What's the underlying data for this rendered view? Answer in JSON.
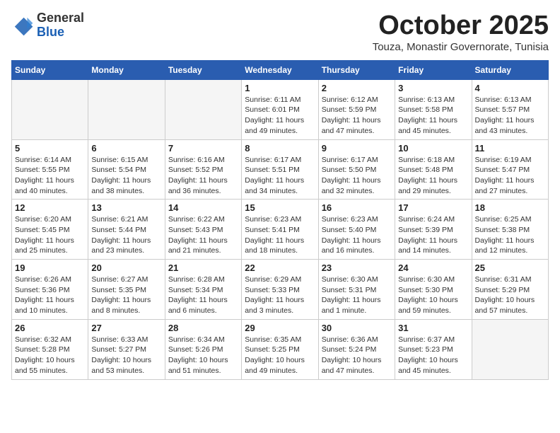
{
  "header": {
    "logo_general": "General",
    "logo_blue": "Blue",
    "month_title": "October 2025",
    "location": "Touza, Monastir Governorate, Tunisia"
  },
  "calendar": {
    "weekdays": [
      "Sunday",
      "Monday",
      "Tuesday",
      "Wednesday",
      "Thursday",
      "Friday",
      "Saturday"
    ],
    "weeks": [
      [
        {
          "day": "",
          "info": ""
        },
        {
          "day": "",
          "info": ""
        },
        {
          "day": "",
          "info": ""
        },
        {
          "day": "1",
          "info": "Sunrise: 6:11 AM\nSunset: 6:01 PM\nDaylight: 11 hours\nand 49 minutes."
        },
        {
          "day": "2",
          "info": "Sunrise: 6:12 AM\nSunset: 5:59 PM\nDaylight: 11 hours\nand 47 minutes."
        },
        {
          "day": "3",
          "info": "Sunrise: 6:13 AM\nSunset: 5:58 PM\nDaylight: 11 hours\nand 45 minutes."
        },
        {
          "day": "4",
          "info": "Sunrise: 6:13 AM\nSunset: 5:57 PM\nDaylight: 11 hours\nand 43 minutes."
        }
      ],
      [
        {
          "day": "5",
          "info": "Sunrise: 6:14 AM\nSunset: 5:55 PM\nDaylight: 11 hours\nand 40 minutes."
        },
        {
          "day": "6",
          "info": "Sunrise: 6:15 AM\nSunset: 5:54 PM\nDaylight: 11 hours\nand 38 minutes."
        },
        {
          "day": "7",
          "info": "Sunrise: 6:16 AM\nSunset: 5:52 PM\nDaylight: 11 hours\nand 36 minutes."
        },
        {
          "day": "8",
          "info": "Sunrise: 6:17 AM\nSunset: 5:51 PM\nDaylight: 11 hours\nand 34 minutes."
        },
        {
          "day": "9",
          "info": "Sunrise: 6:17 AM\nSunset: 5:50 PM\nDaylight: 11 hours\nand 32 minutes."
        },
        {
          "day": "10",
          "info": "Sunrise: 6:18 AM\nSunset: 5:48 PM\nDaylight: 11 hours\nand 29 minutes."
        },
        {
          "day": "11",
          "info": "Sunrise: 6:19 AM\nSunset: 5:47 PM\nDaylight: 11 hours\nand 27 minutes."
        }
      ],
      [
        {
          "day": "12",
          "info": "Sunrise: 6:20 AM\nSunset: 5:45 PM\nDaylight: 11 hours\nand 25 minutes."
        },
        {
          "day": "13",
          "info": "Sunrise: 6:21 AM\nSunset: 5:44 PM\nDaylight: 11 hours\nand 23 minutes."
        },
        {
          "day": "14",
          "info": "Sunrise: 6:22 AM\nSunset: 5:43 PM\nDaylight: 11 hours\nand 21 minutes."
        },
        {
          "day": "15",
          "info": "Sunrise: 6:23 AM\nSunset: 5:41 PM\nDaylight: 11 hours\nand 18 minutes."
        },
        {
          "day": "16",
          "info": "Sunrise: 6:23 AM\nSunset: 5:40 PM\nDaylight: 11 hours\nand 16 minutes."
        },
        {
          "day": "17",
          "info": "Sunrise: 6:24 AM\nSunset: 5:39 PM\nDaylight: 11 hours\nand 14 minutes."
        },
        {
          "day": "18",
          "info": "Sunrise: 6:25 AM\nSunset: 5:38 PM\nDaylight: 11 hours\nand 12 minutes."
        }
      ],
      [
        {
          "day": "19",
          "info": "Sunrise: 6:26 AM\nSunset: 5:36 PM\nDaylight: 11 hours\nand 10 minutes."
        },
        {
          "day": "20",
          "info": "Sunrise: 6:27 AM\nSunset: 5:35 PM\nDaylight: 11 hours\nand 8 minutes."
        },
        {
          "day": "21",
          "info": "Sunrise: 6:28 AM\nSunset: 5:34 PM\nDaylight: 11 hours\nand 6 minutes."
        },
        {
          "day": "22",
          "info": "Sunrise: 6:29 AM\nSunset: 5:33 PM\nDaylight: 11 hours\nand 3 minutes."
        },
        {
          "day": "23",
          "info": "Sunrise: 6:30 AM\nSunset: 5:31 PM\nDaylight: 11 hours\nand 1 minute."
        },
        {
          "day": "24",
          "info": "Sunrise: 6:30 AM\nSunset: 5:30 PM\nDaylight: 10 hours\nand 59 minutes."
        },
        {
          "day": "25",
          "info": "Sunrise: 6:31 AM\nSunset: 5:29 PM\nDaylight: 10 hours\nand 57 minutes."
        }
      ],
      [
        {
          "day": "26",
          "info": "Sunrise: 6:32 AM\nSunset: 5:28 PM\nDaylight: 10 hours\nand 55 minutes."
        },
        {
          "day": "27",
          "info": "Sunrise: 6:33 AM\nSunset: 5:27 PM\nDaylight: 10 hours\nand 53 minutes."
        },
        {
          "day": "28",
          "info": "Sunrise: 6:34 AM\nSunset: 5:26 PM\nDaylight: 10 hours\nand 51 minutes."
        },
        {
          "day": "29",
          "info": "Sunrise: 6:35 AM\nSunset: 5:25 PM\nDaylight: 10 hours\nand 49 minutes."
        },
        {
          "day": "30",
          "info": "Sunrise: 6:36 AM\nSunset: 5:24 PM\nDaylight: 10 hours\nand 47 minutes."
        },
        {
          "day": "31",
          "info": "Sunrise: 6:37 AM\nSunset: 5:23 PM\nDaylight: 10 hours\nand 45 minutes."
        },
        {
          "day": "",
          "info": ""
        }
      ]
    ]
  }
}
